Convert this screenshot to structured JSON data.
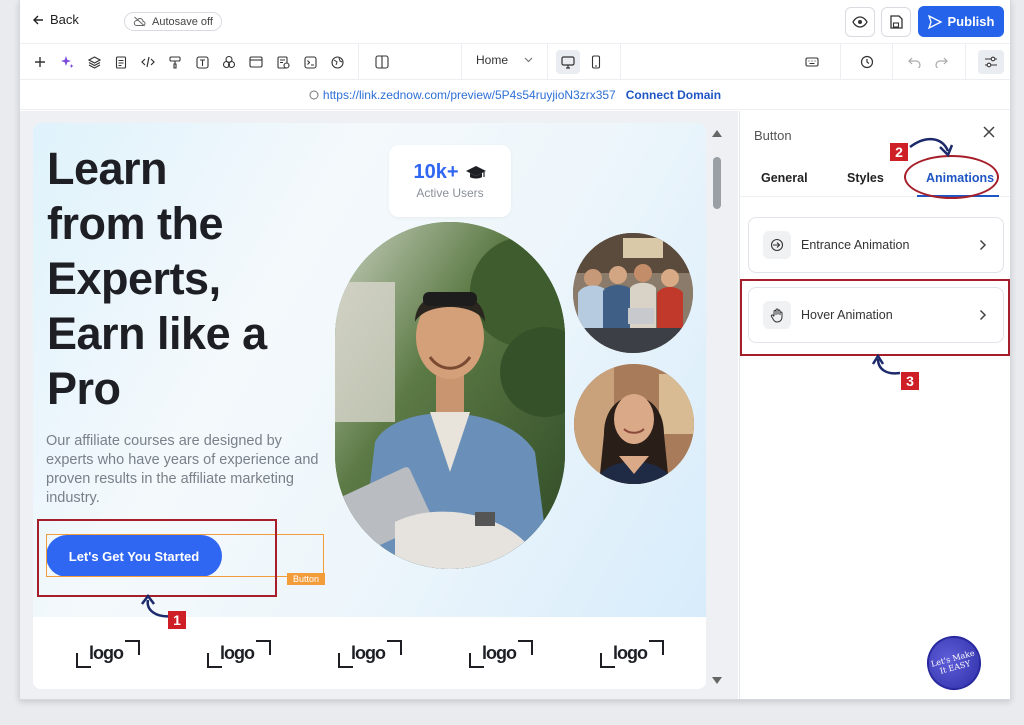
{
  "topbar": {
    "back_label": "Back",
    "autosave_label": "Autosave off",
    "publish_label": "Publish"
  },
  "toolbar": {
    "page_select_value": "Home"
  },
  "urlbar": {
    "url": "https://link.zednow.com/preview/5P4s54ruyjioN3zrx357",
    "connect_label": "Connect Domain"
  },
  "hero": {
    "headline": [
      "Learn",
      "from the",
      "Experts,",
      "Earn like a",
      "Pro"
    ],
    "description": "Our affiliate courses are designed by experts who have years of experience and proven results in the affiliate marketing industry.",
    "cta_label": "Let's Get You Started",
    "selection_tag": "Button",
    "stats_number": "10k+",
    "stats_label": "Active Users"
  },
  "logos": [
    "logo",
    "logo",
    "logo",
    "logo",
    "logo"
  ],
  "panel": {
    "title": "Button",
    "tabs": [
      {
        "label": "General",
        "active": false
      },
      {
        "label": "Styles",
        "active": false
      },
      {
        "label": "Animations",
        "active": true
      }
    ],
    "cards": [
      {
        "label": "Entrance Animation",
        "icon": "entrance-icon"
      },
      {
        "label": "Hover Animation",
        "icon": "hand-icon"
      }
    ]
  },
  "annotations": [
    "1",
    "2",
    "3"
  ],
  "badge_text": "Let's Make It EASY",
  "colors": {
    "primary": "#2563eb",
    "annotation_red": "#a51e2a",
    "selection_orange": "#f39c3a",
    "link_blue": "#1f56c4"
  }
}
